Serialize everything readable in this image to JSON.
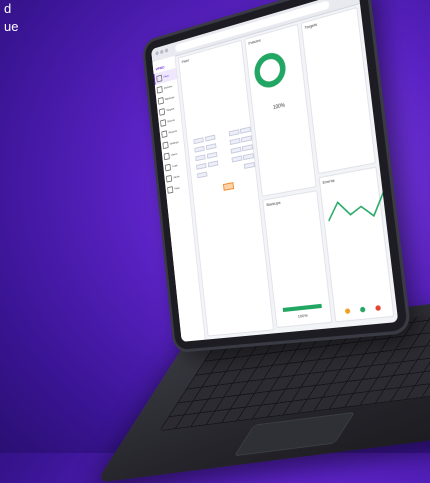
{
  "hero": {
    "line1": "d",
    "line2": "ue"
  },
  "app": {
    "brand": "VPRO",
    "nav": [
      "Fleet",
      "Policies",
      "Backups",
      "Targets",
      "Events",
      "Reports",
      "Settings",
      "Users",
      "Logs",
      "Alerts",
      "Help"
    ],
    "cards": {
      "fleet_title": "Fleet",
      "policies_title": "Policies",
      "policies_percent": "100%",
      "backups_title": "Backups",
      "backups_percent": "100%",
      "targets_title": "Targets",
      "events_title": "Events"
    }
  },
  "colors": {
    "accent": "#6b2fd6",
    "success": "#22a663",
    "background": "#4a1cb5"
  },
  "icons": {
    "nav_icon": "square-outline-icon"
  }
}
